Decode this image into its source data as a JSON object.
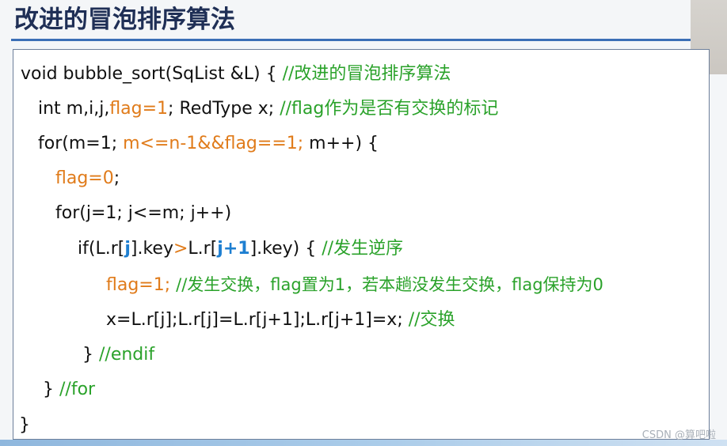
{
  "title": "改进的冒泡排序算法",
  "lines": [
    {
      "segs": [
        {
          "t": "void bubble_sort(SqList &L) { ",
          "c": ""
        },
        {
          "t": "//改进的冒泡排序算法",
          "c": "green"
        }
      ]
    },
    {
      "segs": [
        {
          "t": "int m,i,j,",
          "c": ""
        },
        {
          "t": "flag=1",
          "c": "orange"
        },
        {
          "t": "; RedType x;  ",
          "c": ""
        },
        {
          "t": "//flag作为是否有交换的标记",
          "c": "green"
        }
      ]
    },
    {
      "segs": [
        {
          "t": "for(m=1; ",
          "c": ""
        },
        {
          "t": "m<=n-1&&flag==1;",
          "c": "orange"
        },
        {
          "t": " m++) {",
          "c": ""
        }
      ]
    },
    {
      "segs": [
        {
          "t": "flag=0",
          "c": "orange"
        },
        {
          "t": ";",
          "c": ""
        }
      ]
    },
    {
      "segs": [
        {
          "t": "for(j=1; j<=m; j++)",
          "c": ""
        }
      ]
    },
    {
      "segs": [
        {
          "t": "if(L.r[",
          "c": ""
        },
        {
          "t": "j",
          "c": "blue"
        },
        {
          "t": "].key",
          "c": ""
        },
        {
          "t": ">",
          "c": "orange"
        },
        {
          "t": "L.r[",
          "c": ""
        },
        {
          "t": "j+1",
          "c": "blue"
        },
        {
          "t": "].key) {  ",
          "c": ""
        },
        {
          "t": "//发生逆序",
          "c": "green"
        }
      ]
    },
    {
      "segs": [
        {
          "t": "flag=1;",
          "c": "orange"
        },
        {
          "t": "     ",
          "c": ""
        },
        {
          "t": "//发生交换，flag置为1，若本趟没发生交换，flag保持为0",
          "c": "green cmt"
        }
      ]
    },
    {
      "segs": [
        {
          "t": "x=L.r[j];L.r[j]=L.r[j+1];L.r[j+1]=x; ",
          "c": ""
        },
        {
          "t": "//交换",
          "c": "green"
        }
      ]
    },
    {
      "segs": [
        {
          "t": "} ",
          "c": ""
        },
        {
          "t": "//endif",
          "c": "green"
        }
      ]
    },
    {
      "segs": [
        {
          "t": "} ",
          "c": ""
        },
        {
          "t": "//for",
          "c": "green"
        }
      ]
    },
    {
      "segs": [
        {
          "t": "}",
          "c": ""
        }
      ]
    }
  ],
  "watermark": "CSDN @算吧啦",
  "colors": {
    "keyword_orange": "#e07b1a",
    "comment_green": "#2aa22a",
    "index_blue": "#1e7fd1",
    "title_navy": "#1f2f56",
    "rule_blue": "#3b6fb6"
  }
}
